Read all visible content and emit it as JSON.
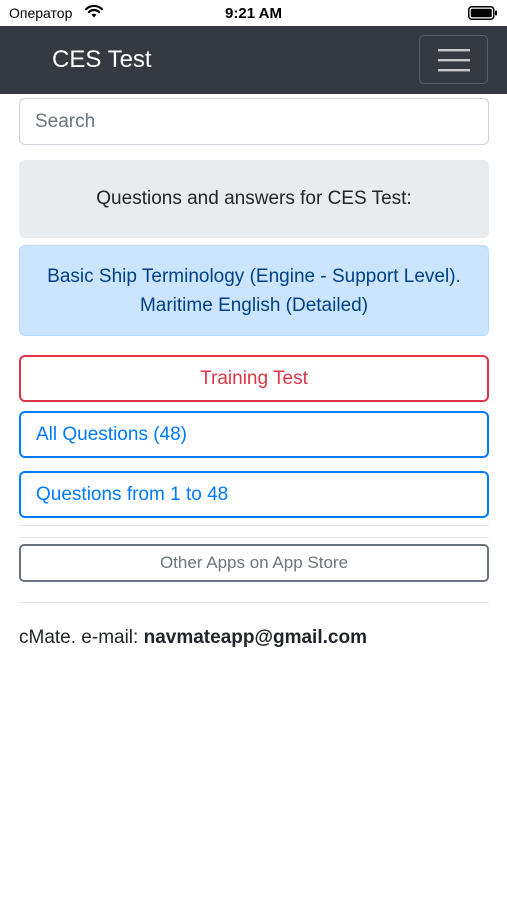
{
  "status_bar": {
    "carrier": "Оператор",
    "time": "9:21 AM"
  },
  "navbar": {
    "brand": "CES Test"
  },
  "search": {
    "placeholder": "Search"
  },
  "intro": {
    "text": "Questions and answers for CES Test:"
  },
  "topic": {
    "title": "Basic Ship Terminology (Engine - Support Level). Maritime English (Detailed)"
  },
  "buttons": {
    "training": "Training Test",
    "all_questions": "All Questions (48)",
    "range": "Questions from 1 to 48",
    "other_apps": "Other Apps on App Store"
  },
  "footer": {
    "prefix": "cMate. e-mail: ",
    "email": "navmateapp@gmail.com"
  },
  "colors": {
    "navbar_bg": "#343a40",
    "danger": "#dc3545",
    "primary": "#007bff",
    "secondary": "#6c757d",
    "info_bg": "#cce5ff"
  }
}
